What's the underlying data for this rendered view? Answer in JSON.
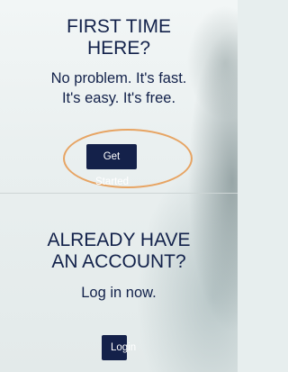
{
  "first_time": {
    "heading_line1": "FIRST TIME",
    "heading_line2": "HERE?",
    "sub_line1": "No problem. It's fast.",
    "sub_line2": "It's easy. It's free.",
    "button_label": "Get Started"
  },
  "returning": {
    "heading_line1": "ALREADY HAVE",
    "heading_line2": "AN ACCOUNT?",
    "sub_line1": "Log in now.",
    "button_label": "Login"
  },
  "colors": {
    "primary": "#14214a",
    "highlight_ring": "#e7a463",
    "background": "#e7eeee"
  }
}
